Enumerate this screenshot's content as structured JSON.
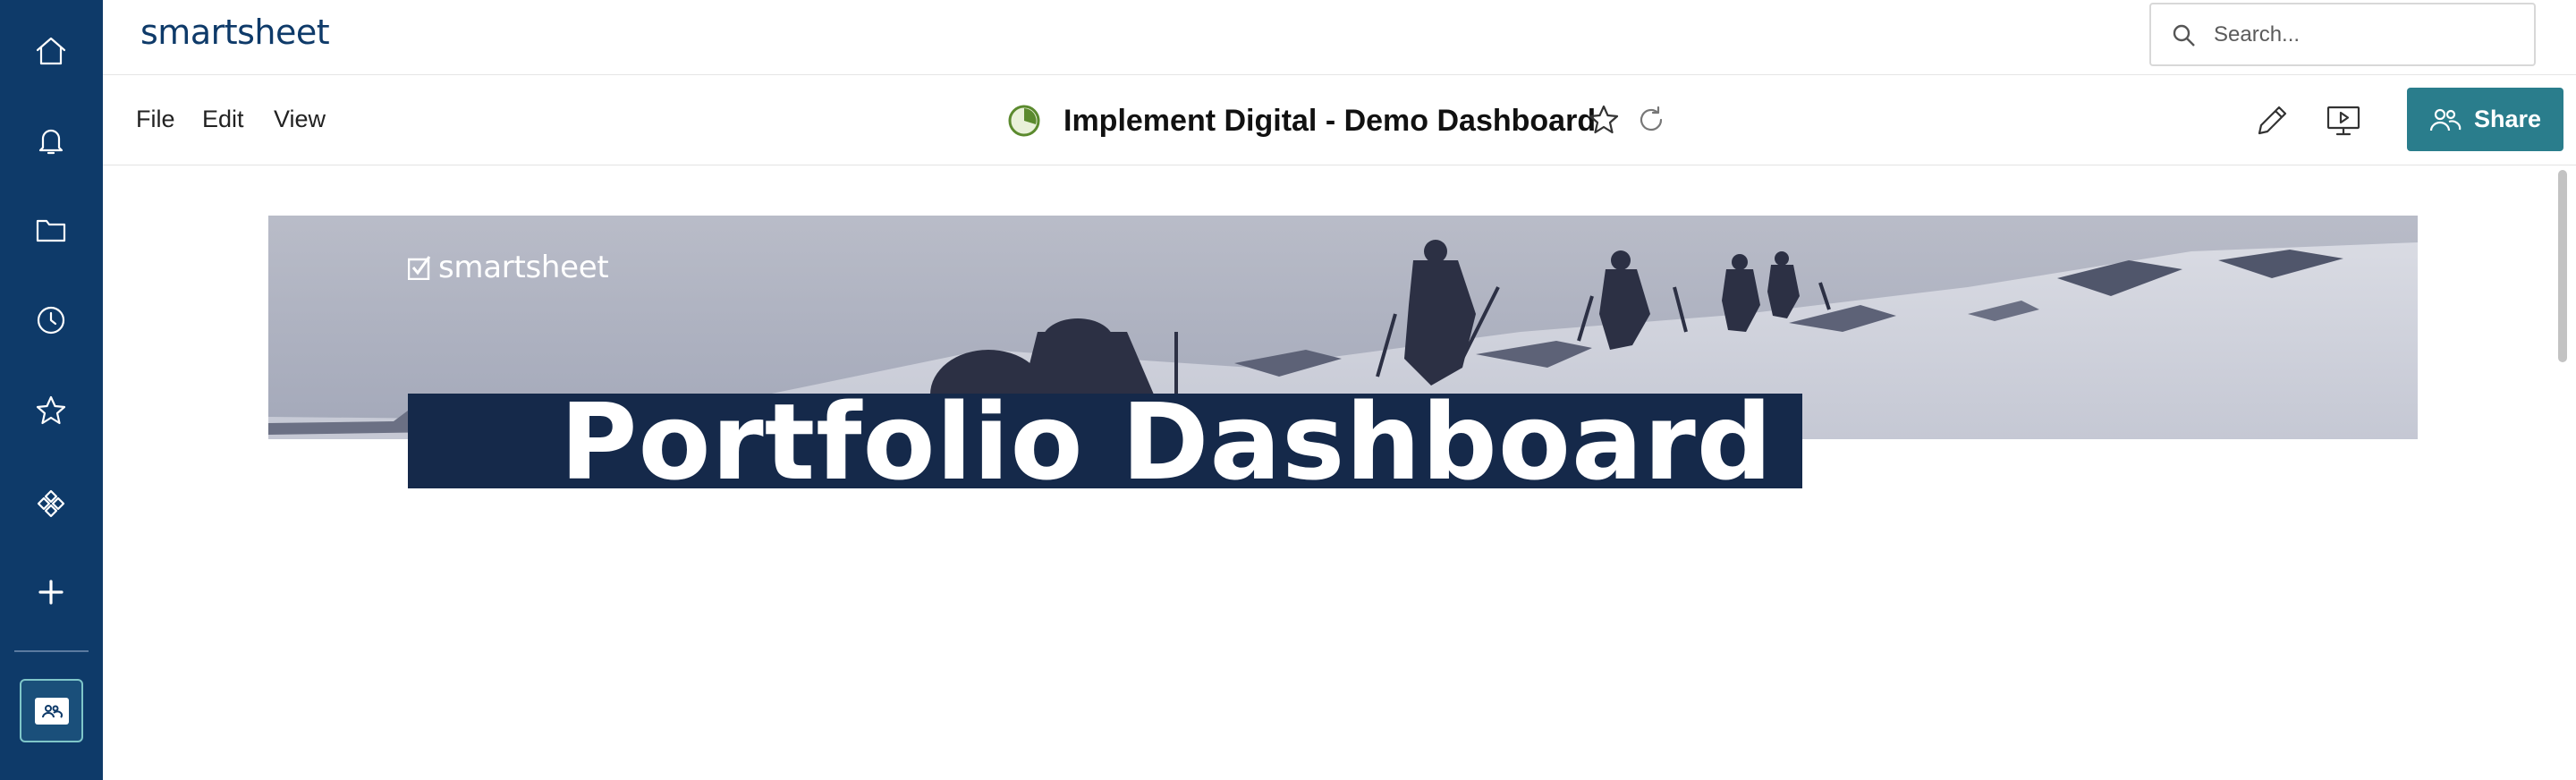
{
  "app": {
    "brand": "smartsheet",
    "colors": {
      "rail": "#0e3a69",
      "accent": "#2a7d8c",
      "banner_plate": "#15294a"
    }
  },
  "rail": {
    "items": [
      {
        "name": "home-icon"
      },
      {
        "name": "bell-icon"
      },
      {
        "name": "folder-icon"
      },
      {
        "name": "clock-icon"
      },
      {
        "name": "star-icon"
      },
      {
        "name": "solutions-icon"
      },
      {
        "name": "plus-icon"
      }
    ],
    "workspace": {
      "icon": "workspace-people-icon"
    }
  },
  "search": {
    "placeholder": "Search..."
  },
  "menu": {
    "file": "File",
    "edit": "Edit",
    "view": "View"
  },
  "dashboard": {
    "title": "Implement Digital - Demo Dashboard"
  },
  "toolbar": {
    "share_label": "Share"
  },
  "banner": {
    "logo_text": "smartsheet",
    "title": "Portfolio Dashboard"
  }
}
